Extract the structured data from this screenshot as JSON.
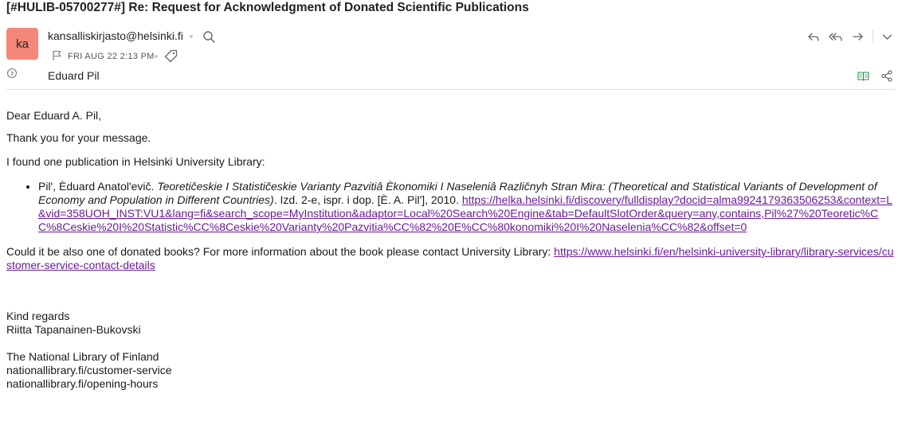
{
  "email": {
    "subject": "[#HULIB-05700277#] Re: Request for Acknowledgment of Donated Scientific Publications",
    "sender": {
      "avatar_initials": "ka",
      "avatar_color": "#f4877a",
      "address": "kansalliskirjasto@helsinki.fi"
    },
    "date": "FRI AUG 22 2:13 PM",
    "recipient": "Eduard Pil",
    "icons": {
      "search": "search-icon",
      "flag": "flag-icon",
      "tag": "tag-icon",
      "expand": "expand-details-icon",
      "reply": "reply-icon",
      "reply_all": "reply-all-icon",
      "forward": "forward-icon",
      "more": "chevron-down-icon",
      "reader": "reader-icon",
      "share": "share-icon"
    },
    "link_color": "#6a1b9a"
  },
  "body": {
    "greeting": "Dear Eduard A. Pil,",
    "thanks": "Thank you for your message.",
    "found": "I found one publication in Helsinki University Library:",
    "publication": {
      "author": "Pil', Èduard Anatol'evič. ",
      "title": "Teoretičeskie I Statističeskie Varianty Pazvitiâ Èkonomiki I Naseleniâ Različnyh Stran Mira: (Theoretical and Statistical Variants of Development of Economy and Population in Different Countries)",
      "details": ". Izd. 2-e, ispr. i dop. [È. A. Pil'], 2010. ",
      "link": "https://helka.helsinki.fi/discovery/fulldisplay?docid=alma9924179363506253&context=L&vid=358UOH_INST:VU1&lang=fi&search_scope=MyInstitution&adaptor=Local%20Search%20Engine&tab=DefaultSlotOrder&query=any,contains,Pil%27%20Teoretic%CC%8Ceskie%20I%20Statistic%CC%8Ceskie%20Varianty%20Pazvitia%CC%82%20E%CC%80konomiki%20I%20Naselenia%CC%82&offset=0"
    },
    "question": "Could it be also one of donated books? For more information about the book please contact University Library: ",
    "contact_link": "https://www.helsinki.fi/en/helsinki-university-library/library-services/customer-service-contact-details",
    "signature": {
      "closing": "Kind regards",
      "name": "Riitta Tapanainen-Bukovski",
      "org": "The National Library of Finland",
      "link1": "nationallibrary.fi/customer-service",
      "link2": "nationallibrary.fi/opening-hours"
    }
  }
}
